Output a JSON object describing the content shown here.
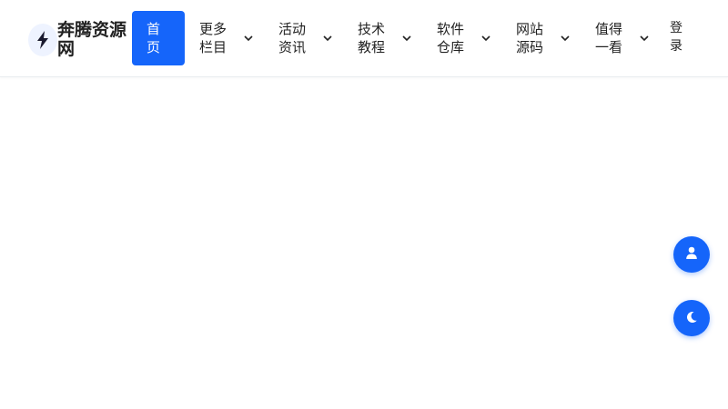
{
  "header": {
    "logo": {
      "icon": "lightning-bolt-icon",
      "title": "奔腾资源网"
    },
    "nav": {
      "home": "首页",
      "items": [
        {
          "label": "更多栏目",
          "icon": "chevron-down-icon"
        },
        {
          "label": "活动资讯",
          "icon": "chevron-down-icon"
        },
        {
          "label": "技术教程",
          "icon": "chevron-down-icon"
        },
        {
          "label": "软件仓库",
          "icon": "chevron-down-icon"
        },
        {
          "label": "网站源码",
          "icon": "chevron-down-icon"
        },
        {
          "label": "值得一看",
          "icon": "chevron-down-icon"
        }
      ]
    },
    "login": "登录"
  },
  "floating_buttons": {
    "user": {
      "icon": "user-icon"
    },
    "theme": {
      "icon": "moon-icon"
    }
  },
  "colors": {
    "accent": "#1565fa",
    "text": "#222222",
    "logo_bg": "#eef3ff"
  }
}
